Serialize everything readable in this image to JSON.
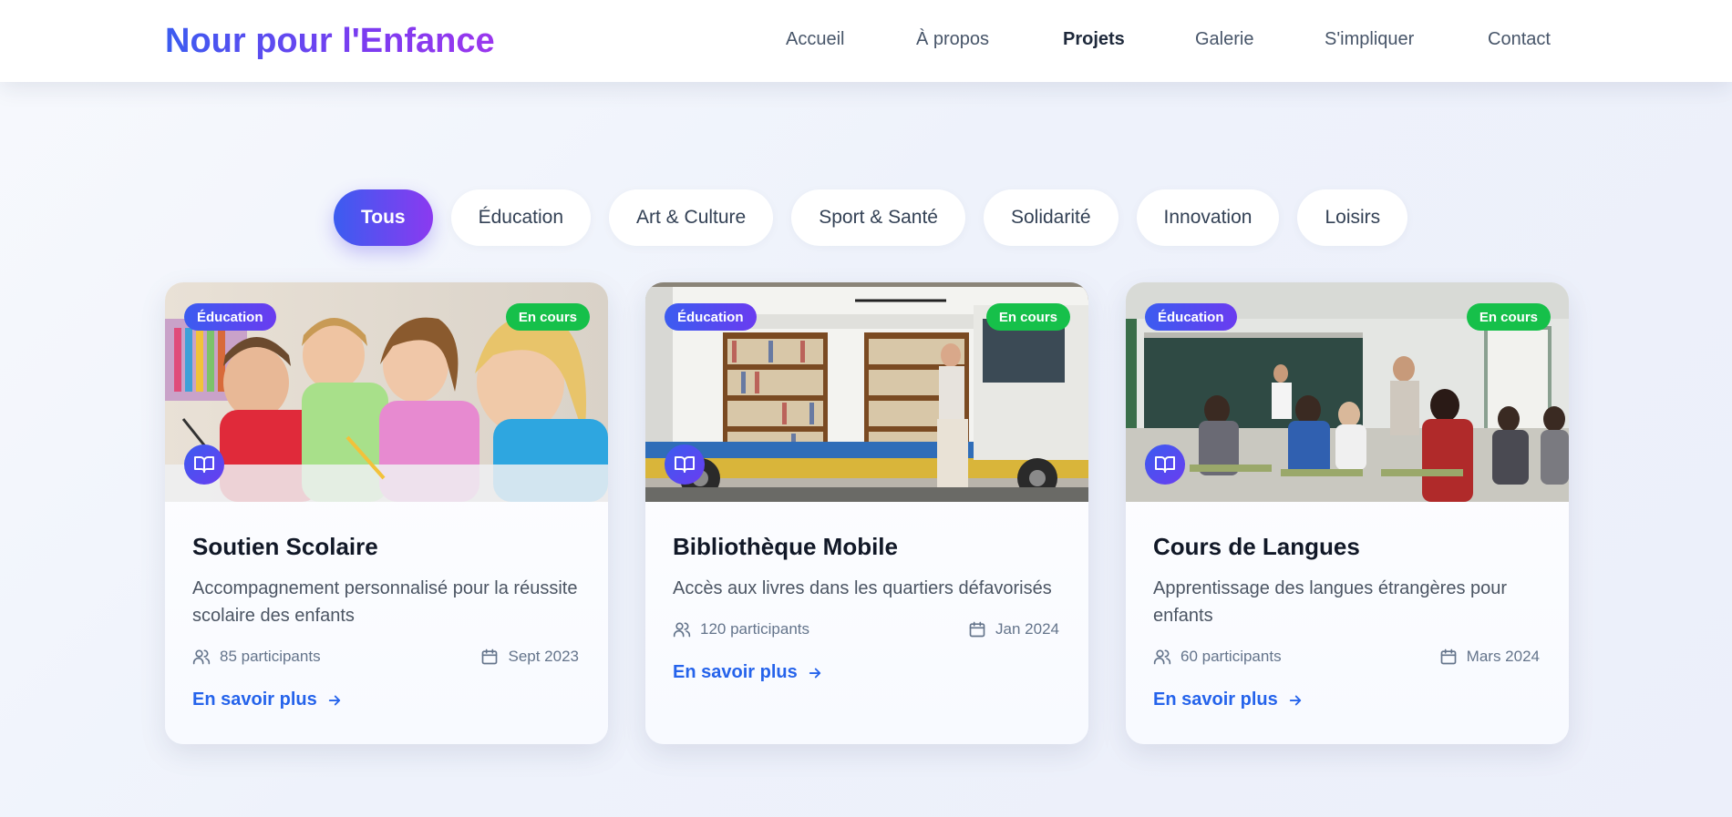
{
  "header": {
    "logo": "Nour pour l'Enfance",
    "nav": [
      "Accueil",
      "À propos",
      "Projets",
      "Galerie",
      "S'impliquer",
      "Contact"
    ],
    "active_nav": "Projets"
  },
  "filters": {
    "items": [
      "Tous",
      "Éducation",
      "Art & Culture",
      "Sport & Santé",
      "Solidarité",
      "Innovation",
      "Loisirs"
    ],
    "active": "Tous"
  },
  "cards": [
    {
      "category": "Éducation",
      "status": "En cours",
      "icon": "book-icon",
      "title": "Soutien Scolaire",
      "description": "Accompagnement personnalisé pour la réussite scolaire des enfants",
      "participants": "85 participants",
      "date": "Sept 2023",
      "link": "En savoir plus"
    },
    {
      "category": "Éducation",
      "status": "En cours",
      "icon": "book-icon",
      "title": "Bibliothèque Mobile",
      "description": "Accès aux livres dans les quartiers défavorisés",
      "participants": "120 participants",
      "date": "Jan 2024",
      "link": "En savoir plus"
    },
    {
      "category": "Éducation",
      "status": "En cours",
      "icon": "book-icon",
      "title": "Cours de Langues",
      "description": "Apprentissage des langues étrangères pour enfants",
      "participants": "60 participants",
      "date": "Mars 2024",
      "link": "En savoir plus"
    }
  ],
  "colors": {
    "brand_start": "#3b5cf0",
    "brand_end": "#9b37ee",
    "status_green": "#16c04a",
    "link_blue": "#2563eb"
  }
}
